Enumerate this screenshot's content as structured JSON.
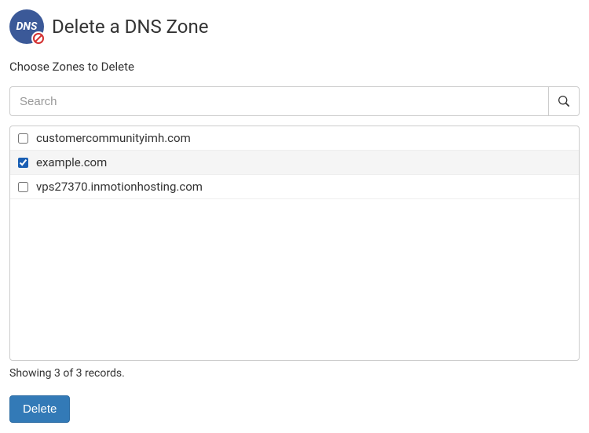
{
  "header": {
    "icon_label": "DNS",
    "title": "Delete a DNS Zone"
  },
  "subtitle": "Choose Zones to Delete",
  "search": {
    "placeholder": "Search",
    "value": ""
  },
  "zones": [
    {
      "name": "customercommunityimh.com",
      "checked": false
    },
    {
      "name": "example.com",
      "checked": true
    },
    {
      "name": "vps27370.inmotionhosting.com",
      "checked": false
    }
  ],
  "record_status": "Showing 3 of 3 records.",
  "buttons": {
    "delete": "Delete"
  }
}
